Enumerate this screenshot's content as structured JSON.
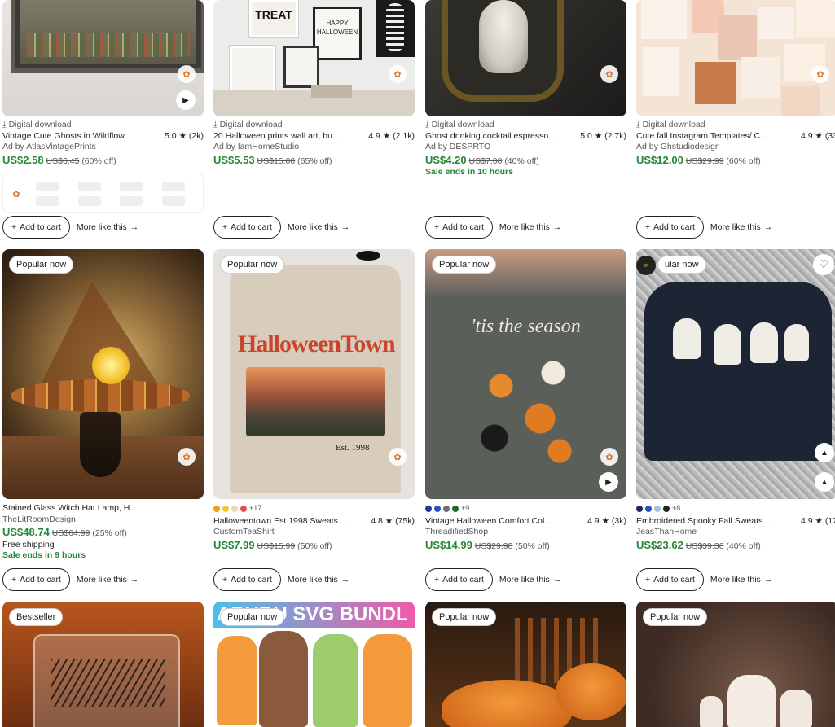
{
  "colors": {
    "price": "#258635",
    "text": "#222222",
    "muted": "#595959"
  },
  "ui": {
    "add_to_cart": "Add to cart",
    "more_like_this": "More like this",
    "digital_download": "Digital download",
    "free_shipping": "Free shipping",
    "plus_icon": "+",
    "arrow_icon": "→",
    "play_icon": "▶",
    "heart_icon": "♡",
    "star": "★"
  },
  "row1": [
    {
      "title": "Vintage Cute Ghosts in Wildflow...",
      "rating": "5.0",
      "count": "(2k)",
      "shop": "Ad by AtlasVintagePrints",
      "price": "US$2.58",
      "original": "US$6.45",
      "discount": "(60% off)"
    },
    {
      "title": "20 Halloween prints wall art, bu...",
      "rating": "4.9",
      "count": "(2.1k)",
      "shop": "Ad by IamHomeStudio",
      "price": "US$5.53",
      "original": "US$15.00",
      "discount": "(65% off)"
    },
    {
      "title": "Ghost drinking cocktail espresso...",
      "rating": "5.0",
      "count": "(2.7k)",
      "shop": "Ad by DESPRTO",
      "price": "US$4.20",
      "original": "US$7.00",
      "discount": "(40% off)",
      "sale": "Sale ends in 10 hours"
    },
    {
      "title": "Cute fall Instagram Templates/ C...",
      "rating": "4.9",
      "count": "(33",
      "shop": "Ad by Ghstudiodesign",
      "price": "US$12.00",
      "original": "US$29.99",
      "discount": "(60% off)"
    }
  ],
  "row2": [
    {
      "badge": "Popular now",
      "title": "Stained Glass Witch Hat Lamp, H...",
      "shop": "TheLitRoomDesign",
      "price": "US$48.74",
      "original": "US$64.99",
      "discount": "(25% off)",
      "sale": "Sale ends in 9 hours"
    },
    {
      "badge": "Popular now",
      "more_colors": "+17",
      "title": "Halloweentown Est 1998 Sweats...",
      "rating": "4.8",
      "count": "(75k)",
      "shop": "CustomTeaShirt",
      "price": "US$7.99",
      "original": "US$15.99",
      "discount": "(50% off)",
      "print_main": "HalloweenTown",
      "print_sub": "Est. 1998",
      "swatches": [
        "#f39a1d",
        "#f5c52a",
        "#f1d6b8",
        "#e84b4b"
      ]
    },
    {
      "badge": "Popular now",
      "more_colors": "+9",
      "title": "Vintage Halloween Comfort Col...",
      "rating": "4.9",
      "count": "(3k)",
      "shop": "ThreadifiedShop",
      "price": "US$14.99",
      "original": "US$29.98",
      "discount": "(50% off)",
      "print_main": "'tis the season",
      "swatches": [
        "#1e3a8a",
        "#2b4fb8",
        "#6e6e6e",
        "#1d6b2f"
      ]
    },
    {
      "badge": "ular now",
      "more_colors": "+8",
      "title": "Embroidered Spooky Fall Sweats...",
      "rating": "4.9",
      "count": "(17",
      "shop": "JeasThanHome",
      "price": "US$23.62",
      "original": "US$39.36",
      "discount": "(40% off)",
      "swatches": [
        "#1b2a5a",
        "#2b4fb8",
        "#9ec3e6",
        "#222222"
      ]
    }
  ],
  "row3": [
    {
      "badge": "Bestseller"
    },
    {
      "badge": "Popular now",
      "banner": "ABUBU SVG BUNDL"
    },
    {
      "badge": "Popular now"
    },
    {
      "badge": "Popular now"
    }
  ],
  "art_text": {
    "treat": "TREAT",
    "happy": "HAPPY",
    "halloween": "HALLOWEEN"
  }
}
